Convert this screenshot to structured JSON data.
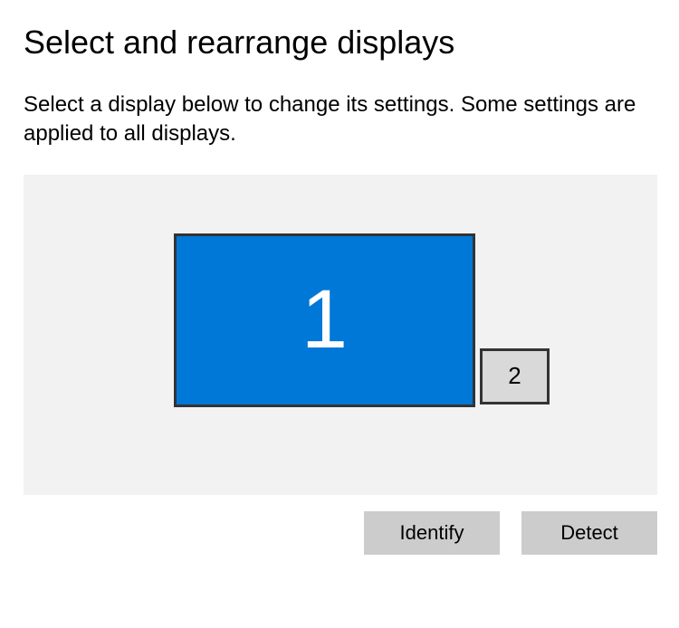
{
  "heading": "Select and rearrange displays",
  "description": "Select a display below to change its settings. Some settings are applied to all displays.",
  "displays": {
    "primary": {
      "label": "1"
    },
    "secondary": {
      "label": "2"
    }
  },
  "buttons": {
    "identify": "Identify",
    "detect": "Detect"
  }
}
